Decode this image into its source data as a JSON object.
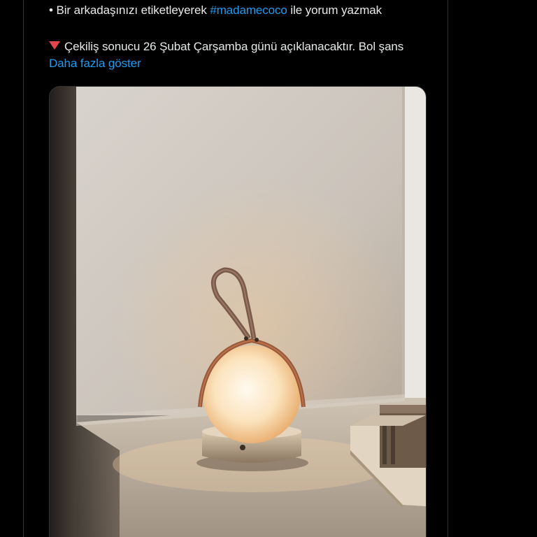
{
  "tweet": {
    "bullet": "•",
    "line1_prefix": "Bir arkadaşınızı etiketleyerek",
    "hashtag": "#madamecoco",
    "line1_suffix": "ile yorum yazmak",
    "announcement": "Çekiliş sonucu 26 Şubat Çarşamba günü açıklanacaktır. Bol şans",
    "show_more": "Daha fazla göster"
  },
  "media": {
    "icon": "red-triangle-down-icon",
    "image_subject": "lamp-photo"
  },
  "colors": {
    "background": "#000000",
    "text": "#e7e9ea",
    "link": "#1d9bf0",
    "divider": "#2f3336",
    "triangle": "#e0464a"
  }
}
